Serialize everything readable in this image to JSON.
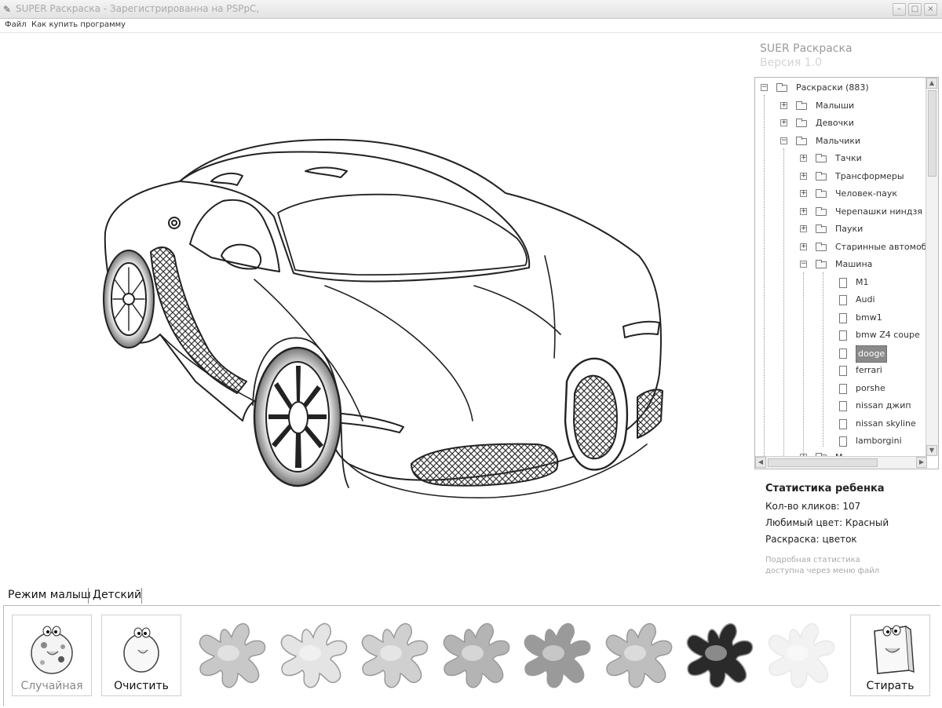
{
  "window": {
    "title": "SUPER Раскраска - Зарегистрированна на PSPpC,",
    "minimize_glyph": "–",
    "maximize_glyph": "□",
    "close_glyph": "×"
  },
  "menu": {
    "file": "Файл",
    "buy": "Как купить программу"
  },
  "sidebar": {
    "app_name": "SUER Раскраска",
    "version": "Версия 1.0",
    "tree": {
      "root": "Раскраски (883)",
      "kids": "Малыши",
      "girls": "Девочки",
      "boys": "Мальчики",
      "boys_children": [
        "Тачки",
        "Трансформеры",
        "Человек-паук",
        "Черепашки ниндзя",
        "Пауки",
        "Старинные автомоби"
      ],
      "car_folder": "Машина",
      "cars": [
        "M1",
        "Audi",
        "bmw1",
        "bmw Z4 coupe",
        "dooge",
        "ferrari",
        "porshe",
        "nissan джип",
        "nissan skyline",
        "lamborgini"
      ],
      "selected_car": "dooge",
      "partial_next": "М..."
    }
  },
  "stats": {
    "title": "Статистика ребенка",
    "clicks": "Кол-во кликов: 107",
    "favorite_color": "Любимый цвет: Красный",
    "coloring": "Раскраска: цветок",
    "note_line1": "Подробная статистика",
    "note_line2": "доступна через меню файл"
  },
  "tabs": {
    "baby_mode": "Режим малыш",
    "child": "Детский"
  },
  "toolbar": {
    "random_label": "Случайная",
    "clear_label": "Очистить",
    "erase_label": "Стирать",
    "palette_colors": [
      "#c8c8c8",
      "#e4e4e4",
      "#d0d0d0",
      "#b4b4b4",
      "#9a9a9a",
      "#bebebe",
      "#2a2a2a",
      "#f2f2f2"
    ]
  }
}
